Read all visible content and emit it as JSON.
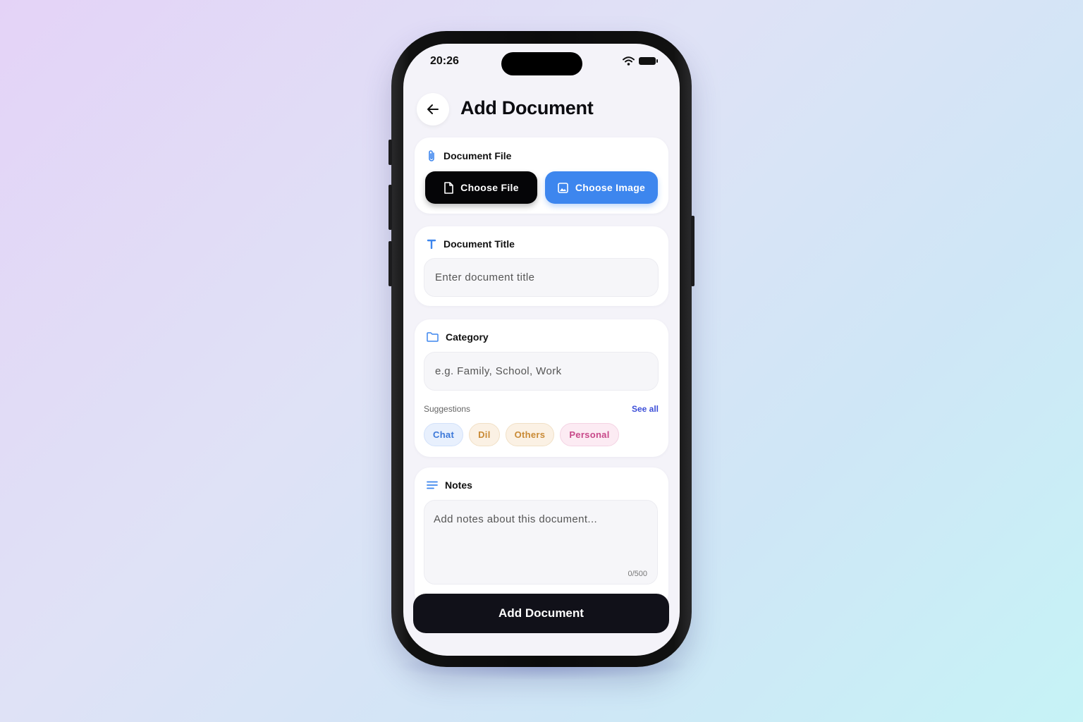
{
  "status_bar": {
    "time": "20:26"
  },
  "header": {
    "title": "Add Document"
  },
  "document_file": {
    "label": "Document File",
    "choose_file_label": "Choose File",
    "choose_image_label": "Choose Image"
  },
  "document_title": {
    "label": "Document Title",
    "placeholder": "Enter document title"
  },
  "category": {
    "label": "Category",
    "placeholder": "e.g. Family, School, Work",
    "suggestions_label": "Suggestions",
    "see_all_label": "See all",
    "chips": [
      "Chat",
      "Dil",
      "Others",
      "Personal"
    ]
  },
  "notes": {
    "label": "Notes",
    "placeholder": "Add notes about this document...",
    "counter": "0/500"
  },
  "submit": {
    "label": "Add Document"
  },
  "colors": {
    "accent": "#3d86ee",
    "primary_dark": "#050507",
    "chip_blue": "#3c78d9",
    "chip_amber": "#c98a35",
    "chip_pink": "#c84889"
  }
}
